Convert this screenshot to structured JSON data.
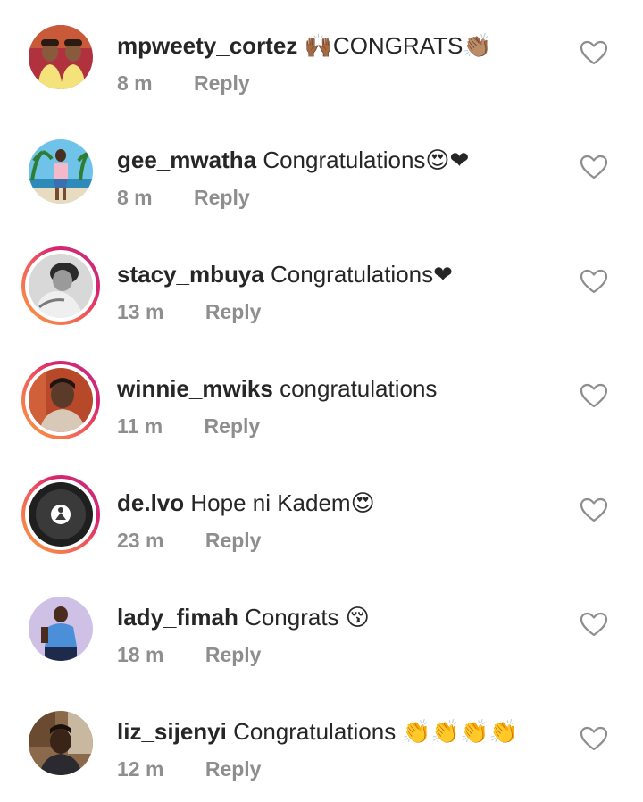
{
  "comments": [
    {
      "username": "mpweety_cortez",
      "text": "🙌🏾CONGRATS👏🏽",
      "time": "8 m",
      "reply": "Reply",
      "story_ring": false,
      "avatar": "two-women-avatar"
    },
    {
      "username": "gee_mwatha",
      "text": "Congratulations😍❤",
      "time": "8 m",
      "reply": "Reply",
      "story_ring": false,
      "avatar": "beach-avatar"
    },
    {
      "username": "stacy_mbuya",
      "text": "Congratulations❤",
      "time": "13 m",
      "reply": "Reply",
      "story_ring": true,
      "avatar": "bw-portrait-avatar"
    },
    {
      "username": "winnie_mwiks",
      "text": "congratulations",
      "time": "11 m",
      "reply": "Reply",
      "story_ring": true,
      "avatar": "red-portrait-avatar"
    },
    {
      "username": "de.lvo",
      "text": "Hope ni Kadem😍",
      "time": "23 m",
      "reply": "Reply",
      "story_ring": true,
      "avatar": "dark-logo-avatar"
    },
    {
      "username": "lady_fimah",
      "text": "Congrats 😚",
      "time": "18 m",
      "reply": "Reply",
      "story_ring": false,
      "avatar": "woman-purple-avatar"
    },
    {
      "username": "liz_sijenyi",
      "text": "Congratulations 👏👏👏👏",
      "time": "12 m",
      "reply": "Reply",
      "story_ring": false,
      "avatar": "woman-indoor-avatar"
    }
  ],
  "colors": {
    "ring_start": "#f9a03f",
    "ring_end": "#c13584",
    "meta": "#8e8e8e",
    "text": "#262626"
  }
}
